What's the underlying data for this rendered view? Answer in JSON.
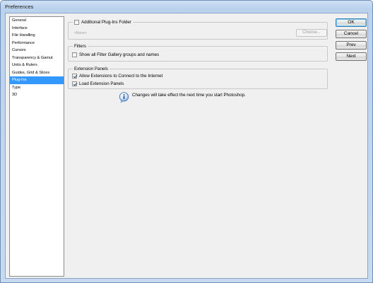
{
  "window": {
    "title": "Preferences"
  },
  "sidebar": {
    "items": [
      {
        "label": "General"
      },
      {
        "label": "Interface"
      },
      {
        "label": "File Handling"
      },
      {
        "label": "Performance"
      },
      {
        "label": "Cursors"
      },
      {
        "label": "Transparency & Gamut"
      },
      {
        "label": "Units & Rulers"
      },
      {
        "label": "Guides, Grid & Slices"
      },
      {
        "label": "Plug-Ins",
        "selected": true
      },
      {
        "label": "Type"
      },
      {
        "label": "3D"
      }
    ]
  },
  "plugins_folder": {
    "label": "Additional Plug-Ins Folder",
    "checked": false,
    "path": "<None>",
    "choose_label": "Choose..."
  },
  "filters": {
    "title": "Filters",
    "show_all_label": "Show all Filter Gallery groups and names",
    "checked": false
  },
  "extension_panels": {
    "title": "Extension Panels",
    "allow_internet_label": "Allow Extensions to Connect to the Internet",
    "allow_internet_checked": true,
    "load_panels_label": "Load Extension Panels",
    "load_panels_checked": true
  },
  "notice": {
    "text": "Changes will take effect the next time you start Photoshop.",
    "icon": "info-icon"
  },
  "buttons": {
    "ok": "OK",
    "cancel": "Cancel",
    "prev": "Prev",
    "next": "Next"
  },
  "colors": {
    "selection": "#3399ff",
    "title_bar": "#bcd3ee",
    "dialog_bg": "#f0f0f0"
  }
}
